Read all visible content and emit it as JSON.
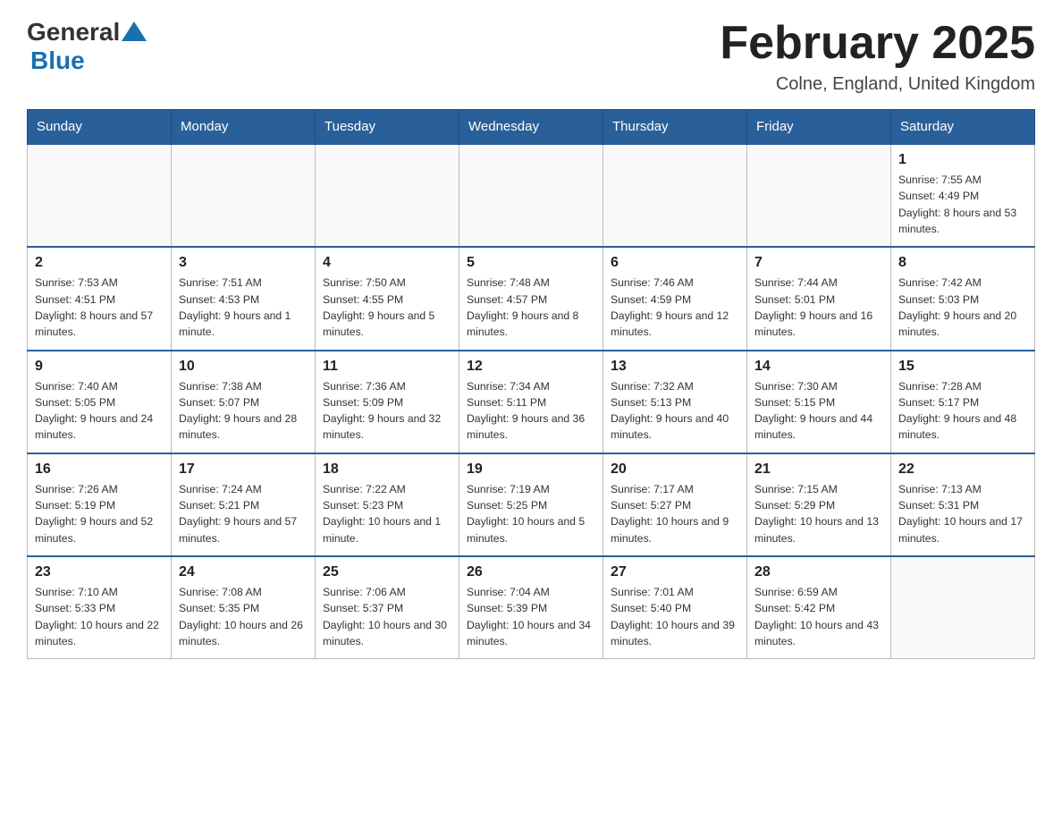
{
  "header": {
    "logo_general": "General",
    "logo_blue": "Blue",
    "title": "February 2025",
    "subtitle": "Colne, England, United Kingdom"
  },
  "weekdays": [
    "Sunday",
    "Monday",
    "Tuesday",
    "Wednesday",
    "Thursday",
    "Friday",
    "Saturday"
  ],
  "weeks": [
    [
      {
        "day": "",
        "info": ""
      },
      {
        "day": "",
        "info": ""
      },
      {
        "day": "",
        "info": ""
      },
      {
        "day": "",
        "info": ""
      },
      {
        "day": "",
        "info": ""
      },
      {
        "day": "",
        "info": ""
      },
      {
        "day": "1",
        "info": "Sunrise: 7:55 AM\nSunset: 4:49 PM\nDaylight: 8 hours and 53 minutes."
      }
    ],
    [
      {
        "day": "2",
        "info": "Sunrise: 7:53 AM\nSunset: 4:51 PM\nDaylight: 8 hours and 57 minutes."
      },
      {
        "day": "3",
        "info": "Sunrise: 7:51 AM\nSunset: 4:53 PM\nDaylight: 9 hours and 1 minute."
      },
      {
        "day": "4",
        "info": "Sunrise: 7:50 AM\nSunset: 4:55 PM\nDaylight: 9 hours and 5 minutes."
      },
      {
        "day": "5",
        "info": "Sunrise: 7:48 AM\nSunset: 4:57 PM\nDaylight: 9 hours and 8 minutes."
      },
      {
        "day": "6",
        "info": "Sunrise: 7:46 AM\nSunset: 4:59 PM\nDaylight: 9 hours and 12 minutes."
      },
      {
        "day": "7",
        "info": "Sunrise: 7:44 AM\nSunset: 5:01 PM\nDaylight: 9 hours and 16 minutes."
      },
      {
        "day": "8",
        "info": "Sunrise: 7:42 AM\nSunset: 5:03 PM\nDaylight: 9 hours and 20 minutes."
      }
    ],
    [
      {
        "day": "9",
        "info": "Sunrise: 7:40 AM\nSunset: 5:05 PM\nDaylight: 9 hours and 24 minutes."
      },
      {
        "day": "10",
        "info": "Sunrise: 7:38 AM\nSunset: 5:07 PM\nDaylight: 9 hours and 28 minutes."
      },
      {
        "day": "11",
        "info": "Sunrise: 7:36 AM\nSunset: 5:09 PM\nDaylight: 9 hours and 32 minutes."
      },
      {
        "day": "12",
        "info": "Sunrise: 7:34 AM\nSunset: 5:11 PM\nDaylight: 9 hours and 36 minutes."
      },
      {
        "day": "13",
        "info": "Sunrise: 7:32 AM\nSunset: 5:13 PM\nDaylight: 9 hours and 40 minutes."
      },
      {
        "day": "14",
        "info": "Sunrise: 7:30 AM\nSunset: 5:15 PM\nDaylight: 9 hours and 44 minutes."
      },
      {
        "day": "15",
        "info": "Sunrise: 7:28 AM\nSunset: 5:17 PM\nDaylight: 9 hours and 48 minutes."
      }
    ],
    [
      {
        "day": "16",
        "info": "Sunrise: 7:26 AM\nSunset: 5:19 PM\nDaylight: 9 hours and 52 minutes."
      },
      {
        "day": "17",
        "info": "Sunrise: 7:24 AM\nSunset: 5:21 PM\nDaylight: 9 hours and 57 minutes."
      },
      {
        "day": "18",
        "info": "Sunrise: 7:22 AM\nSunset: 5:23 PM\nDaylight: 10 hours and 1 minute."
      },
      {
        "day": "19",
        "info": "Sunrise: 7:19 AM\nSunset: 5:25 PM\nDaylight: 10 hours and 5 minutes."
      },
      {
        "day": "20",
        "info": "Sunrise: 7:17 AM\nSunset: 5:27 PM\nDaylight: 10 hours and 9 minutes."
      },
      {
        "day": "21",
        "info": "Sunrise: 7:15 AM\nSunset: 5:29 PM\nDaylight: 10 hours and 13 minutes."
      },
      {
        "day": "22",
        "info": "Sunrise: 7:13 AM\nSunset: 5:31 PM\nDaylight: 10 hours and 17 minutes."
      }
    ],
    [
      {
        "day": "23",
        "info": "Sunrise: 7:10 AM\nSunset: 5:33 PM\nDaylight: 10 hours and 22 minutes."
      },
      {
        "day": "24",
        "info": "Sunrise: 7:08 AM\nSunset: 5:35 PM\nDaylight: 10 hours and 26 minutes."
      },
      {
        "day": "25",
        "info": "Sunrise: 7:06 AM\nSunset: 5:37 PM\nDaylight: 10 hours and 30 minutes."
      },
      {
        "day": "26",
        "info": "Sunrise: 7:04 AM\nSunset: 5:39 PM\nDaylight: 10 hours and 34 minutes."
      },
      {
        "day": "27",
        "info": "Sunrise: 7:01 AM\nSunset: 5:40 PM\nDaylight: 10 hours and 39 minutes."
      },
      {
        "day": "28",
        "info": "Sunrise: 6:59 AM\nSunset: 5:42 PM\nDaylight: 10 hours and 43 minutes."
      },
      {
        "day": "",
        "info": ""
      }
    ]
  ]
}
